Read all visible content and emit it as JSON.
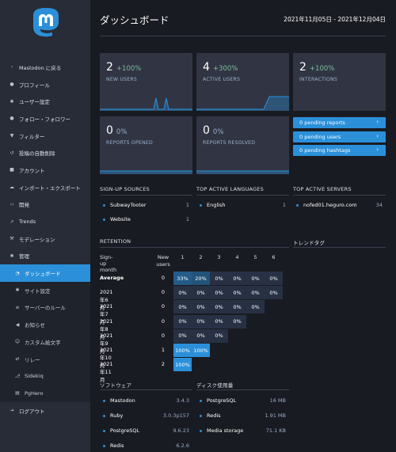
{
  "sidebar": {
    "items": [
      {
        "icon": "chevron-left-icon",
        "glyph": "‹",
        "label": "Mastodon に戻る"
      },
      {
        "icon": "user-icon",
        "glyph": "●",
        "label": "プロフィール"
      },
      {
        "icon": "gear-icon",
        "glyph": "✱",
        "label": "ユーザー設定"
      },
      {
        "icon": "users-icon",
        "glyph": "●",
        "label": "フォロー・フォロワー"
      },
      {
        "icon": "filter-icon",
        "glyph": "▼",
        "label": "フィルター"
      },
      {
        "icon": "history-icon",
        "glyph": "↺",
        "label": "投稿の自動削除"
      },
      {
        "icon": "lock-icon",
        "glyph": "■",
        "label": "アカウント"
      },
      {
        "icon": "cloud-icon",
        "glyph": "☁",
        "label": "インポート・エクスポート"
      },
      {
        "icon": "code-icon",
        "glyph": "‹›",
        "label": "開発"
      },
      {
        "icon": "trends-icon",
        "glyph": "↗",
        "label": "Trends"
      },
      {
        "icon": "gavel-icon",
        "glyph": "⚒",
        "label": "モデレーション"
      },
      {
        "icon": "cogs-icon",
        "glyph": "✱",
        "label": "管理"
      }
    ],
    "subitems": [
      {
        "icon": "dashboard-icon",
        "glyph": "◔",
        "label": "ダッシュボード",
        "active": true
      },
      {
        "icon": "gear-icon",
        "glyph": "✱",
        "label": "サイト設定"
      },
      {
        "icon": "list-icon",
        "glyph": "≡",
        "label": "サーバーのルール"
      },
      {
        "icon": "bullhorn-icon",
        "glyph": "◀",
        "label": "お知らせ"
      },
      {
        "icon": "smile-icon",
        "glyph": "☺",
        "label": "カスタム絵文字"
      },
      {
        "icon": "exchange-icon",
        "glyph": "⇄",
        "label": "リレー"
      },
      {
        "icon": "sidekiq-icon",
        "glyph": "⎇",
        "label": "Sidekiq"
      },
      {
        "icon": "database-icon",
        "glyph": "▤",
        "label": "PgHero"
      }
    ],
    "logout": {
      "icon": "sign-out-icon",
      "glyph": "⇥",
      "label": "ログアウト"
    }
  },
  "header": {
    "title": "ダッシュボード",
    "date_range": "2021年11月05日 - 2021年12月04日"
  },
  "metrics": {
    "new_users": {
      "value": "2",
      "change": "+100%",
      "label": "NEW USERS"
    },
    "active_users": {
      "value": "4",
      "change": "+300%",
      "label": "ACTIVE USERS"
    },
    "interactions": {
      "value": "2",
      "change": "+100%",
      "label": "INTERACTIONS"
    },
    "reports_opened": {
      "value": "0",
      "change": "0%",
      "label": "REPORTS OPENED"
    },
    "reports_resolved": {
      "value": "0",
      "change": "0%",
      "label": "REPORTS RESOLVED"
    }
  },
  "pending": {
    "reports": "0 pending reports",
    "users": "0 pending users",
    "hashtags": "0 pending hashtags"
  },
  "signup_sources": {
    "title": "SIGN-UP SOURCES",
    "rows": [
      {
        "name": "SubwayTooter",
        "value": "1"
      },
      {
        "name": "Website",
        "value": "1"
      }
    ]
  },
  "top_languages": {
    "title": "TOP ACTIVE LANGUAGES",
    "rows": [
      {
        "name": "English",
        "value": "1"
      }
    ]
  },
  "top_servers": {
    "title": "TOP ACTIVE SERVERS",
    "rows": [
      {
        "name": "nofed01.heguro.com",
        "value": "34"
      }
    ]
  },
  "retention": {
    "title": "RETENTION",
    "headers": {
      "month": "Sign-up month",
      "users": "New users",
      "periods": [
        "1",
        "2",
        "3",
        "4",
        "5",
        "6"
      ]
    },
    "rows": [
      {
        "label": "Average",
        "users": "0",
        "cells": [
          "33%",
          "20%",
          "0%",
          "0%",
          "0%",
          "0%"
        ]
      },
      {
        "label": "2021年6月",
        "users": "0",
        "cells": [
          "0%",
          "0%",
          "0%",
          "0%",
          "0%",
          "0%"
        ]
      },
      {
        "label": "2021年7月",
        "users": "0",
        "cells": [
          "0%",
          "0%",
          "0%",
          "0%",
          "0%"
        ]
      },
      {
        "label": "2021年8月",
        "users": "0",
        "cells": [
          "0%",
          "0%",
          "0%",
          "0%"
        ]
      },
      {
        "label": "2021年9月",
        "users": "0",
        "cells": [
          "0%",
          "0%",
          "0%"
        ]
      },
      {
        "label": "2021年10月",
        "users": "1",
        "cells": [
          "100%",
          "100%"
        ]
      },
      {
        "label": "2021年11月",
        "users": "2",
        "cells": [
          "100%"
        ]
      }
    ]
  },
  "trending_tags": {
    "title": "トレンドタグ"
  },
  "software": {
    "title": "ソフトウェア",
    "rows": [
      {
        "name": "Mastodon",
        "value": "3.4.3"
      },
      {
        "name": "Ruby",
        "value": "3.0.3p157"
      },
      {
        "name": "PostgreSQL",
        "value": "9.6.23"
      },
      {
        "name": "Redis",
        "value": "6.2.6"
      }
    ]
  },
  "disk": {
    "title": "ディスク使用量",
    "rows": [
      {
        "name": "PostgreSQL",
        "value": "16 MB"
      },
      {
        "name": "Redis",
        "value": "1.91 MB"
      },
      {
        "name": "Media storage",
        "value": "71.1 KB"
      }
    ]
  },
  "colors": {
    "accent": "#2b90d9",
    "positive": "#79bd9a",
    "panel": "#313543",
    "sidebar": "#282c37",
    "bg": "#191b22"
  }
}
